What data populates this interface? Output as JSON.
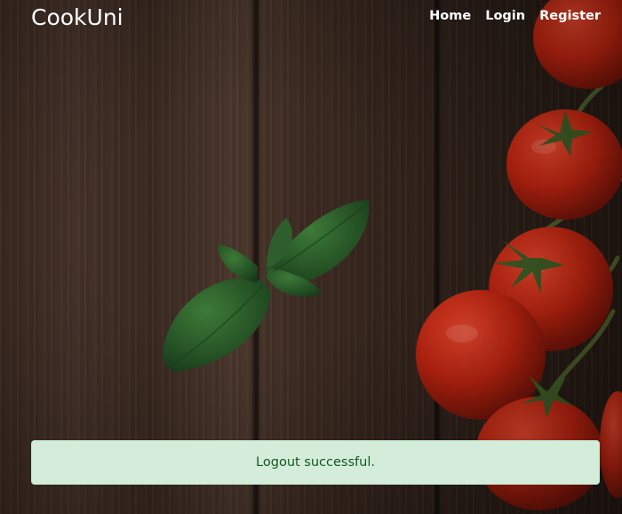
{
  "header": {
    "logo": "CookUni",
    "nav": [
      {
        "label": "Home"
      },
      {
        "label": "Login"
      },
      {
        "label": "Register"
      }
    ]
  },
  "alert": {
    "message": "Logout successful.",
    "type": "success"
  },
  "colors": {
    "alert_bg": "#d4edda",
    "alert_text": "#155724",
    "wood": "#3d2b22"
  },
  "background": {
    "icons": [
      "basil-icon",
      "tomato-icon"
    ]
  }
}
